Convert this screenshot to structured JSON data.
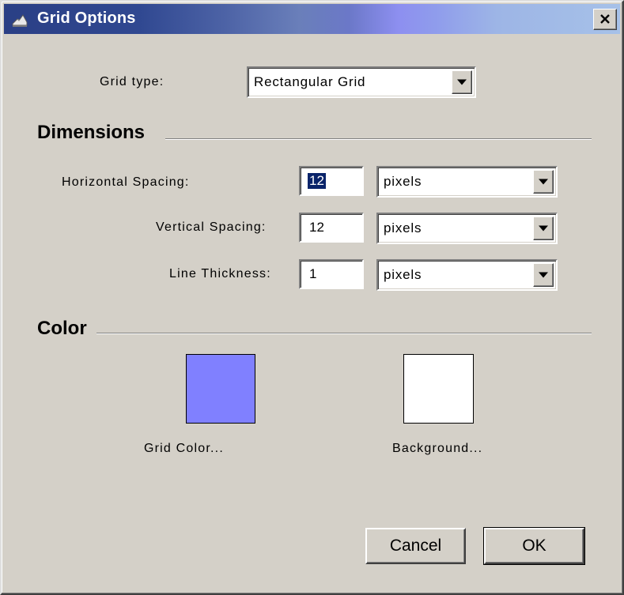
{
  "window": {
    "title": "Grid Options",
    "icon": "dialog-app-icon",
    "close_icon": "close-icon"
  },
  "grid_type": {
    "label": "Grid type:",
    "value": "Rectangular Grid"
  },
  "dimensions": {
    "heading": "Dimensions",
    "horizontal": {
      "label": "Horizontal Spacing:",
      "value": "12",
      "unit": "pixels"
    },
    "vertical": {
      "label": "Vertical Spacing:",
      "value": "12",
      "unit": "pixels"
    },
    "thickness": {
      "label": "Line Thickness:",
      "value": "1",
      "unit": "pixels"
    }
  },
  "color": {
    "heading": "Color",
    "grid": {
      "label": "Grid Color...",
      "swatch": "#8080ff"
    },
    "background": {
      "label": "Background...",
      "swatch": "#ffffff"
    }
  },
  "buttons": {
    "cancel": "Cancel",
    "ok": "OK"
  }
}
